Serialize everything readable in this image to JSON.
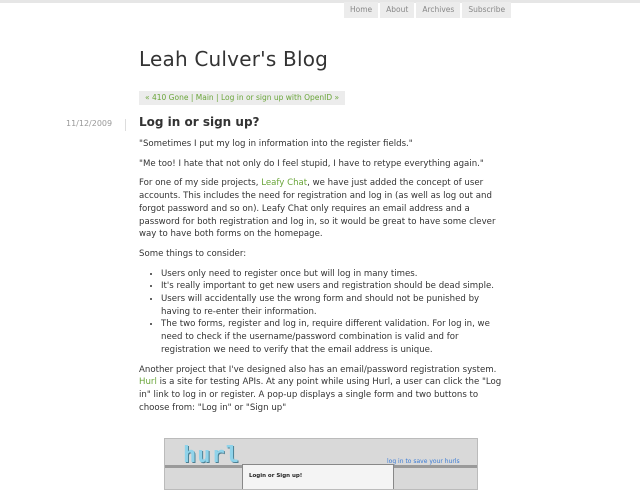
{
  "nav": {
    "items": [
      {
        "label": "Home"
      },
      {
        "label": "About"
      },
      {
        "label": "Archives"
      },
      {
        "label": "Subscribe"
      }
    ]
  },
  "blog": {
    "title": "Leah Culver's Blog"
  },
  "breadcrumb": {
    "prev": "« 410 Gone",
    "sep1": " | ",
    "main": "Main",
    "sep2": " | ",
    "next": "Log in or sign up with OpenID »"
  },
  "post": {
    "date": "11/12/2009",
    "title": "Log in or sign up?",
    "p1": "\"Sometimes I put my log in information into the register fields.\"",
    "p2": "\"Me too! I hate that not only do I feel stupid, I have to retype everything again.\"",
    "p3_before": "For one of my side projects, ",
    "p3_link": "Leafy Chat",
    "p3_after": ", we have just added the concept of user accounts. This includes the need for registration and log in (as well as log out and forgot password and so on). Leafy Chat only requires an email address and a password for both registration and log in, so it would be great to have some clever way to have both forms on the homepage.",
    "p4": "Some things to consider:",
    "bullets": [
      "Users only need to register once but will log in many times.",
      "It's really important to get new users and registration should be dead simple.",
      "Users will accidentally use the wrong form and should not be punished by having to re-enter their information.",
      "The two forms, register and log in, require different validation. For log in, we need to check if the username/password combination is valid and for registration we need to verify that the email address is unique."
    ],
    "p5_before": "Another project that I've designed also has an email/password registration system. ",
    "p5_link": "Hurl",
    "p5_after": " is a site for testing APIs. At any point while using Hurl, a user can click the \"Log in\" link to log in or register. A pop-up displays a single form and two buttons to choose from: \"Log in\" or \"Sign up\""
  },
  "screenshot": {
    "logo": "hurl",
    "login_link": "log in",
    "login_rest": " to save your hurls",
    "modal_title": "Login or Sign up!"
  }
}
